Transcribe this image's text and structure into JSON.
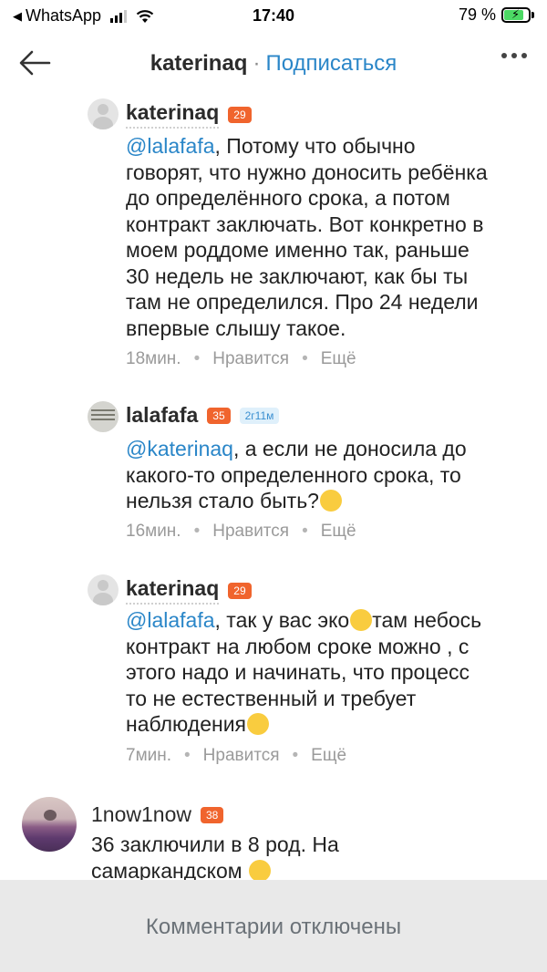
{
  "status_bar": {
    "back_app": "WhatsApp",
    "time": "17:40",
    "battery_percent": "79 %",
    "battery_level": 0.79
  },
  "header": {
    "username": "katerinaq",
    "separator": "·",
    "subscribe_label": "Подписаться",
    "icons": [
      "back-arrow-icon",
      "more-icon"
    ]
  },
  "comments": [
    {
      "author": "katerinaq",
      "level": "29",
      "mention": "@lalafafa",
      "text_lines": [
        ", Потому что обычно",
        "говорят, что нужно доносить ребёнка",
        "до определённого срока, а потом",
        "контракт заключать. Вот конкретно в",
        "моем роддоме именно так, раньше",
        "30 недель не заключают, как бы ты",
        "там не определился. Про 24 недели",
        "впервые слышу такое."
      ],
      "time": "18мин.",
      "like": "Нравится",
      "more": "Ещё"
    },
    {
      "author": "lalafafa",
      "level": "35",
      "tag": "2г11м",
      "mention": "@katerinaq",
      "text_lines": [
        ", а если не доносила до",
        "какого-то определенного срока, то",
        "нельзя стало быть?"
      ],
      "time": "16мин.",
      "like": "Нравится",
      "more": "Ещё"
    },
    {
      "author": "katerinaq",
      "level": "29",
      "mention": "@lalafafa",
      "text_lines": [
        ", так у вас эко",
        "там небось",
        "контракт на любом сроке можно , с",
        "этого надо и начинать, что процесс",
        "то не естественный и требует",
        "наблюдения"
      ],
      "time": "7мин.",
      "like": "Нравится",
      "more": "Ещё"
    },
    {
      "author": "1now1now",
      "level": "38",
      "text_lines": [
        "36 заключили в 8 род. На",
        "самаркандском"
      ]
    }
  ],
  "footer": {
    "label": "Комментарии отключены"
  }
}
